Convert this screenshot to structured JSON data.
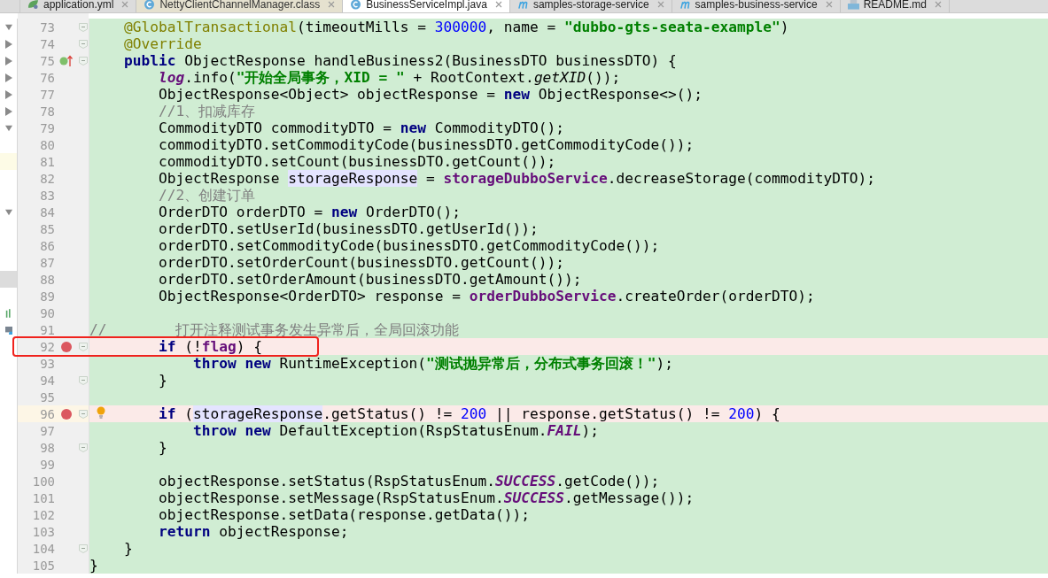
{
  "tabs": [
    {
      "label": "application.yml",
      "kind": "yml",
      "selected": false,
      "inactive": false
    },
    {
      "label": "NettyClientChannelManager.class",
      "kind": "class",
      "selected": false,
      "inactive": true
    },
    {
      "label": "BusinessServiceImpl.java",
      "kind": "java",
      "selected": true,
      "inactive": false
    },
    {
      "label": "samples-storage-service",
      "kind": "module",
      "selected": false,
      "inactive": false
    },
    {
      "label": "samples-business-service",
      "kind": "module",
      "selected": false,
      "inactive": false
    },
    {
      "label": "README.md",
      "kind": "md",
      "selected": false,
      "inactive": false
    }
  ],
  "lines": [
    {
      "number": "73",
      "fold": true,
      "breakpoint": false,
      "tree_arrow": {
        "expanded": true
      },
      "tokens": [
        {
          "kind": "annotation",
          "text": "    @GlobalTransactional"
        },
        {
          "kind": "plain",
          "text": "(timeoutMills = "
        },
        {
          "kind": "number",
          "text": "300000"
        },
        {
          "kind": "plain",
          "text": ", name = "
        },
        {
          "kind": "string",
          "text": "\"dubbo-gts-seata-example\""
        },
        {
          "kind": "plain",
          "text": ")"
        }
      ]
    },
    {
      "number": "74",
      "fold": true,
      "breakpoint": false,
      "tree_arrow": {
        "expanded": false
      },
      "tokens": [
        {
          "kind": "annotation",
          "text": "    @Override"
        }
      ]
    },
    {
      "number": "75",
      "fold": true,
      "breakpoint": false,
      "tree_arrow": {
        "expanded": false
      },
      "gutter_icon": {
        "kind": "override"
      },
      "tokens": [
        {
          "kind": "keyword",
          "text": "    public"
        },
        {
          "kind": "plain",
          "text": " ObjectResponse handleBusiness2(BusinessDTO businessDTO) {"
        }
      ]
    },
    {
      "number": "76",
      "fold": false,
      "breakpoint": false,
      "tree_arrow": {
        "expanded": false
      },
      "tokens": [
        {
          "kind": "static_field",
          "text": "        log"
        },
        {
          "kind": "plain",
          "text": ".info("
        },
        {
          "kind": "string",
          "text": "\"开始全局事务，XID = \""
        },
        {
          "kind": "plain",
          "text": " + RootContext."
        },
        {
          "kind": "static_call",
          "text": "getXID"
        },
        {
          "kind": "plain",
          "text": "());"
        }
      ]
    },
    {
      "number": "77",
      "fold": false,
      "breakpoint": false,
      "tree_arrow": {
        "expanded": false
      },
      "tokens": [
        {
          "kind": "plain",
          "text": "        ObjectResponse<Object> objectResponse = "
        },
        {
          "kind": "keyword",
          "text": "new"
        },
        {
          "kind": "plain",
          "text": " ObjectResponse<>();"
        }
      ]
    },
    {
      "number": "78",
      "fold": false,
      "breakpoint": false,
      "tree_arrow": {
        "expanded": false
      },
      "tokens": [
        {
          "kind": "comment",
          "text": "        //1、扣减库存"
        }
      ]
    },
    {
      "number": "79",
      "fold": false,
      "breakpoint": false,
      "tree_arrow": {
        "expanded": true
      },
      "tokens": [
        {
          "kind": "plain",
          "text": "        CommodityDTO commodityDTO = "
        },
        {
          "kind": "keyword",
          "text": "new"
        },
        {
          "kind": "plain",
          "text": " CommodityDTO();"
        }
      ]
    },
    {
      "number": "80",
      "fold": false,
      "breakpoint": false,
      "tokens": [
        {
          "kind": "plain",
          "text": "        commodityDTO.setCommodityCode(businessDTO.getCommodityCode());"
        }
      ]
    },
    {
      "number": "81",
      "fold": false,
      "breakpoint": false,
      "tree_highlight": {
        "kind": "current"
      },
      "tokens": [
        {
          "kind": "plain",
          "text": "        commodityDTO.setCount(businessDTO.getCount());"
        }
      ]
    },
    {
      "number": "82",
      "fold": false,
      "breakpoint": false,
      "tokens": [
        {
          "kind": "plain",
          "text": "        ObjectResponse "
        },
        {
          "kind": "usage",
          "text": "storageResponse"
        },
        {
          "kind": "plain",
          "text": " = "
        },
        {
          "kind": "field",
          "text": "storageDubboService"
        },
        {
          "kind": "plain",
          "text": ".decreaseStorage(commodityDTO);"
        }
      ]
    },
    {
      "number": "83",
      "fold": false,
      "breakpoint": false,
      "tokens": [
        {
          "kind": "comment",
          "text": "        //2、创建订单"
        }
      ]
    },
    {
      "number": "84",
      "fold": false,
      "breakpoint": false,
      "tree_arrow": {
        "expanded": true
      },
      "tokens": [
        {
          "kind": "plain",
          "text": "        OrderDTO orderDTO = "
        },
        {
          "kind": "keyword",
          "text": "new"
        },
        {
          "kind": "plain",
          "text": " OrderDTO();"
        }
      ]
    },
    {
      "number": "85",
      "fold": false,
      "breakpoint": false,
      "tokens": [
        {
          "kind": "plain",
          "text": "        orderDTO.setUserId(businessDTO.getUserId());"
        }
      ]
    },
    {
      "number": "86",
      "fold": false,
      "breakpoint": false,
      "tokens": [
        {
          "kind": "plain",
          "text": "        orderDTO.setCommodityCode(businessDTO.getCommodityCode());"
        }
      ]
    },
    {
      "number": "87",
      "fold": false,
      "breakpoint": false,
      "tokens": [
        {
          "kind": "plain",
          "text": "        orderDTO.setOrderCount(businessDTO.getCount());"
        }
      ]
    },
    {
      "number": "88",
      "fold": false,
      "breakpoint": false,
      "tree_highlight": {
        "kind": "selected"
      },
      "tokens": [
        {
          "kind": "plain",
          "text": "        orderDTO.setOrderAmount(businessDTO.getAmount());"
        }
      ]
    },
    {
      "number": "89",
      "fold": false,
      "breakpoint": false,
      "tokens": [
        {
          "kind": "plain",
          "text": "        ObjectResponse<OrderDTO> response = "
        },
        {
          "kind": "field",
          "text": "orderDubboService"
        },
        {
          "kind": "plain",
          "text": ".createOrder(orderDTO);"
        }
      ]
    },
    {
      "number": "90",
      "fold": false,
      "breakpoint": false,
      "tree_icon": {
        "kind": "chart"
      }
    },
    {
      "number": "91",
      "fold": false,
      "breakpoint": false,
      "tree_icon": {
        "kind": "console"
      },
      "tokens": [
        {
          "kind": "comment",
          "text": "//        打开注释测试事务发生异常后，全局回滚功能"
        }
      ]
    },
    {
      "number": "92",
      "fold": true,
      "breakpoint": true,
      "tokens": [
        {
          "kind": "keyword",
          "text": "        if"
        },
        {
          "kind": "plain",
          "text": " (!"
        },
        {
          "kind": "field",
          "text": "flag"
        },
        {
          "kind": "plain",
          "text": ") {"
        }
      ]
    },
    {
      "number": "93",
      "fold": false,
      "breakpoint": false,
      "tokens": [
        {
          "kind": "keyword",
          "text": "            throw new"
        },
        {
          "kind": "plain",
          "text": " RuntimeException("
        },
        {
          "kind": "string",
          "text": "\"测试抛异常后，分布式事务回滚！\""
        },
        {
          "kind": "plain",
          "text": ");"
        }
      ]
    },
    {
      "number": "94",
      "fold": true,
      "breakpoint": false,
      "tokens": [
        {
          "kind": "plain",
          "text": "        }"
        }
      ]
    },
    {
      "number": "95",
      "fold": false,
      "breakpoint": false
    },
    {
      "number": "96",
      "fold": true,
      "breakpoint": true,
      "gutter_icon": {
        "kind": "bulb"
      },
      "tokens": [
        {
          "kind": "keyword",
          "text": "        if"
        },
        {
          "kind": "plain",
          "text": " ("
        },
        {
          "kind": "usage",
          "text": "storageResponse"
        },
        {
          "kind": "plain",
          "text": ".getStatus() != "
        },
        {
          "kind": "number",
          "text": "200"
        },
        {
          "kind": "plain",
          "text": " || response.getStatus() != "
        },
        {
          "kind": "number",
          "text": "200"
        },
        {
          "kind": "plain",
          "text": ") {"
        }
      ]
    },
    {
      "number": "97",
      "fold": false,
      "breakpoint": false,
      "tokens": [
        {
          "kind": "keyword",
          "text": "            throw new"
        },
        {
          "kind": "plain",
          "text": " DefaultException(RspStatusEnum."
        },
        {
          "kind": "static_field",
          "text": "FAIL"
        },
        {
          "kind": "plain",
          "text": ");"
        }
      ]
    },
    {
      "number": "98",
      "fold": true,
      "breakpoint": false,
      "tokens": [
        {
          "kind": "plain",
          "text": "        }"
        }
      ]
    },
    {
      "number": "99",
      "fold": false,
      "breakpoint": false
    },
    {
      "number": "100",
      "fold": false,
      "breakpoint": false,
      "tokens": [
        {
          "kind": "plain",
          "text": "        objectResponse.setStatus(RspStatusEnum."
        },
        {
          "kind": "static_field",
          "text": "SUCCESS"
        },
        {
          "kind": "plain",
          "text": ".getCode());"
        }
      ]
    },
    {
      "number": "101",
      "fold": false,
      "breakpoint": false,
      "tokens": [
        {
          "kind": "plain",
          "text": "        objectResponse.setMessage(RspStatusEnum."
        },
        {
          "kind": "static_field",
          "text": "SUCCESS"
        },
        {
          "kind": "plain",
          "text": ".getMessage());"
        }
      ]
    },
    {
      "number": "102",
      "fold": false,
      "breakpoint": false,
      "tokens": [
        {
          "kind": "plain",
          "text": "        objectResponse.setData(response.getData());"
        }
      ]
    },
    {
      "number": "103",
      "fold": false,
      "breakpoint": false,
      "tokens": [
        {
          "kind": "keyword",
          "text": "        return"
        },
        {
          "kind": "plain",
          "text": " objectResponse;"
        }
      ]
    },
    {
      "number": "104",
      "fold": true,
      "breakpoint": false,
      "tokens": [
        {
          "kind": "plain",
          "text": "    }"
        }
      ]
    },
    {
      "number": "105",
      "fold": false,
      "breakpoint": false,
      "tokens": [
        {
          "kind": "plain",
          "text": "}"
        }
      ]
    }
  ]
}
